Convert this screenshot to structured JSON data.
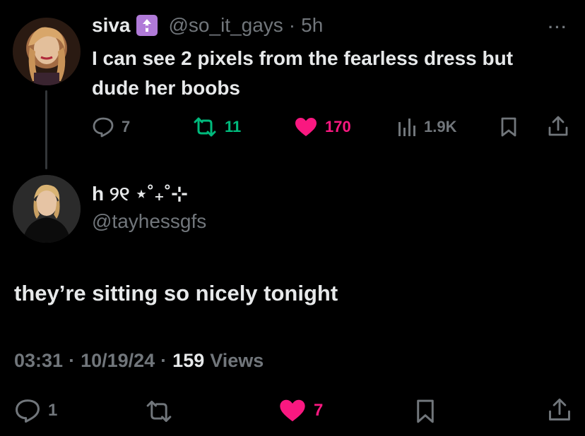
{
  "parent_tweet": {
    "display_name": "siva",
    "badge_emoji": "🛐",
    "handle": "@so_it_gays",
    "separator": "·",
    "time_ago": "5h",
    "more": "···",
    "text_line1": "I can see 2 pixels from the fearless dress but",
    "text_line2": "dude her boobs",
    "metrics": {
      "replies": "7",
      "retweets": "11",
      "likes": "170",
      "views": "1.9K"
    }
  },
  "main_tweet": {
    "display_name": "h ୨୧ ⋆˚₊˚⊹",
    "handle": "@tayhessgfs",
    "text": "they’re sitting so nicely tonight",
    "time": "03:31",
    "date": "10/19/24",
    "views_count": "159",
    "views_label": "Views",
    "separator": "·",
    "actions": {
      "replies": "1",
      "likes": "7"
    }
  },
  "colors": {
    "background": "#000000",
    "text": "#e7e9ea",
    "muted": "#71767b",
    "retweet": "#00ba7c",
    "like": "#f91880"
  }
}
